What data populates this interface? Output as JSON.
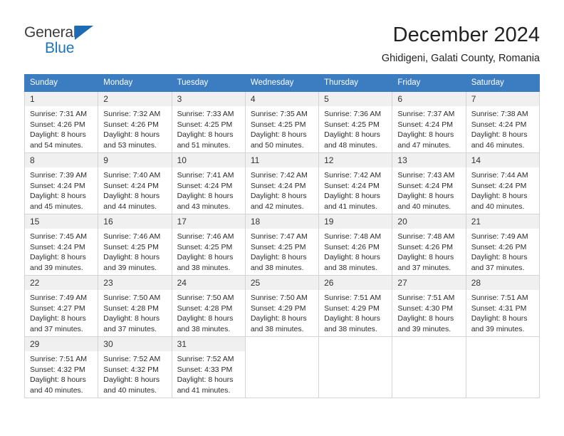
{
  "brand": {
    "line1": "General",
    "line2": "Blue",
    "triangle_color": "#1b6cb5"
  },
  "header": {
    "title": "December 2024",
    "subtitle": "Ghidigeni, Galati County, Romania"
  },
  "theme": {
    "header_bg": "#3b7dc0",
    "daynum_bg": "#f0f0f0",
    "border": "#d4d4d4"
  },
  "weekday_headers": [
    "Sunday",
    "Monday",
    "Tuesday",
    "Wednesday",
    "Thursday",
    "Friday",
    "Saturday"
  ],
  "weeks": [
    [
      {
        "day": "1",
        "sunrise": "Sunrise: 7:31 AM",
        "sunset": "Sunset: 4:26 PM",
        "daylight1": "Daylight: 8 hours",
        "daylight2": "and 54 minutes."
      },
      {
        "day": "2",
        "sunrise": "Sunrise: 7:32 AM",
        "sunset": "Sunset: 4:26 PM",
        "daylight1": "Daylight: 8 hours",
        "daylight2": "and 53 minutes."
      },
      {
        "day": "3",
        "sunrise": "Sunrise: 7:33 AM",
        "sunset": "Sunset: 4:25 PM",
        "daylight1": "Daylight: 8 hours",
        "daylight2": "and 51 minutes."
      },
      {
        "day": "4",
        "sunrise": "Sunrise: 7:35 AM",
        "sunset": "Sunset: 4:25 PM",
        "daylight1": "Daylight: 8 hours",
        "daylight2": "and 50 minutes."
      },
      {
        "day": "5",
        "sunrise": "Sunrise: 7:36 AM",
        "sunset": "Sunset: 4:25 PM",
        "daylight1": "Daylight: 8 hours",
        "daylight2": "and 48 minutes."
      },
      {
        "day": "6",
        "sunrise": "Sunrise: 7:37 AM",
        "sunset": "Sunset: 4:24 PM",
        "daylight1": "Daylight: 8 hours",
        "daylight2": "and 47 minutes."
      },
      {
        "day": "7",
        "sunrise": "Sunrise: 7:38 AM",
        "sunset": "Sunset: 4:24 PM",
        "daylight1": "Daylight: 8 hours",
        "daylight2": "and 46 minutes."
      }
    ],
    [
      {
        "day": "8",
        "sunrise": "Sunrise: 7:39 AM",
        "sunset": "Sunset: 4:24 PM",
        "daylight1": "Daylight: 8 hours",
        "daylight2": "and 45 minutes."
      },
      {
        "day": "9",
        "sunrise": "Sunrise: 7:40 AM",
        "sunset": "Sunset: 4:24 PM",
        "daylight1": "Daylight: 8 hours",
        "daylight2": "and 44 minutes."
      },
      {
        "day": "10",
        "sunrise": "Sunrise: 7:41 AM",
        "sunset": "Sunset: 4:24 PM",
        "daylight1": "Daylight: 8 hours",
        "daylight2": "and 43 minutes."
      },
      {
        "day": "11",
        "sunrise": "Sunrise: 7:42 AM",
        "sunset": "Sunset: 4:24 PM",
        "daylight1": "Daylight: 8 hours",
        "daylight2": "and 42 minutes."
      },
      {
        "day": "12",
        "sunrise": "Sunrise: 7:42 AM",
        "sunset": "Sunset: 4:24 PM",
        "daylight1": "Daylight: 8 hours",
        "daylight2": "and 41 minutes."
      },
      {
        "day": "13",
        "sunrise": "Sunrise: 7:43 AM",
        "sunset": "Sunset: 4:24 PM",
        "daylight1": "Daylight: 8 hours",
        "daylight2": "and 40 minutes."
      },
      {
        "day": "14",
        "sunrise": "Sunrise: 7:44 AM",
        "sunset": "Sunset: 4:24 PM",
        "daylight1": "Daylight: 8 hours",
        "daylight2": "and 40 minutes."
      }
    ],
    [
      {
        "day": "15",
        "sunrise": "Sunrise: 7:45 AM",
        "sunset": "Sunset: 4:24 PM",
        "daylight1": "Daylight: 8 hours",
        "daylight2": "and 39 minutes."
      },
      {
        "day": "16",
        "sunrise": "Sunrise: 7:46 AM",
        "sunset": "Sunset: 4:25 PM",
        "daylight1": "Daylight: 8 hours",
        "daylight2": "and 39 minutes."
      },
      {
        "day": "17",
        "sunrise": "Sunrise: 7:46 AM",
        "sunset": "Sunset: 4:25 PM",
        "daylight1": "Daylight: 8 hours",
        "daylight2": "and 38 minutes."
      },
      {
        "day": "18",
        "sunrise": "Sunrise: 7:47 AM",
        "sunset": "Sunset: 4:25 PM",
        "daylight1": "Daylight: 8 hours",
        "daylight2": "and 38 minutes."
      },
      {
        "day": "19",
        "sunrise": "Sunrise: 7:48 AM",
        "sunset": "Sunset: 4:26 PM",
        "daylight1": "Daylight: 8 hours",
        "daylight2": "and 38 minutes."
      },
      {
        "day": "20",
        "sunrise": "Sunrise: 7:48 AM",
        "sunset": "Sunset: 4:26 PM",
        "daylight1": "Daylight: 8 hours",
        "daylight2": "and 37 minutes."
      },
      {
        "day": "21",
        "sunrise": "Sunrise: 7:49 AM",
        "sunset": "Sunset: 4:26 PM",
        "daylight1": "Daylight: 8 hours",
        "daylight2": "and 37 minutes."
      }
    ],
    [
      {
        "day": "22",
        "sunrise": "Sunrise: 7:49 AM",
        "sunset": "Sunset: 4:27 PM",
        "daylight1": "Daylight: 8 hours",
        "daylight2": "and 37 minutes."
      },
      {
        "day": "23",
        "sunrise": "Sunrise: 7:50 AM",
        "sunset": "Sunset: 4:28 PM",
        "daylight1": "Daylight: 8 hours",
        "daylight2": "and 37 minutes."
      },
      {
        "day": "24",
        "sunrise": "Sunrise: 7:50 AM",
        "sunset": "Sunset: 4:28 PM",
        "daylight1": "Daylight: 8 hours",
        "daylight2": "and 38 minutes."
      },
      {
        "day": "25",
        "sunrise": "Sunrise: 7:50 AM",
        "sunset": "Sunset: 4:29 PM",
        "daylight1": "Daylight: 8 hours",
        "daylight2": "and 38 minutes."
      },
      {
        "day": "26",
        "sunrise": "Sunrise: 7:51 AM",
        "sunset": "Sunset: 4:29 PM",
        "daylight1": "Daylight: 8 hours",
        "daylight2": "and 38 minutes."
      },
      {
        "day": "27",
        "sunrise": "Sunrise: 7:51 AM",
        "sunset": "Sunset: 4:30 PM",
        "daylight1": "Daylight: 8 hours",
        "daylight2": "and 39 minutes."
      },
      {
        "day": "28",
        "sunrise": "Sunrise: 7:51 AM",
        "sunset": "Sunset: 4:31 PM",
        "daylight1": "Daylight: 8 hours",
        "daylight2": "and 39 minutes."
      }
    ],
    [
      {
        "day": "29",
        "sunrise": "Sunrise: 7:51 AM",
        "sunset": "Sunset: 4:32 PM",
        "daylight1": "Daylight: 8 hours",
        "daylight2": "and 40 minutes."
      },
      {
        "day": "30",
        "sunrise": "Sunrise: 7:52 AM",
        "sunset": "Sunset: 4:32 PM",
        "daylight1": "Daylight: 8 hours",
        "daylight2": "and 40 minutes."
      },
      {
        "day": "31",
        "sunrise": "Sunrise: 7:52 AM",
        "sunset": "Sunset: 4:33 PM",
        "daylight1": "Daylight: 8 hours",
        "daylight2": "and 41 minutes."
      },
      {
        "day": "",
        "sunrise": "",
        "sunset": "",
        "daylight1": "",
        "daylight2": ""
      },
      {
        "day": "",
        "sunrise": "",
        "sunset": "",
        "daylight1": "",
        "daylight2": ""
      },
      {
        "day": "",
        "sunrise": "",
        "sunset": "",
        "daylight1": "",
        "daylight2": ""
      },
      {
        "day": "",
        "sunrise": "",
        "sunset": "",
        "daylight1": "",
        "daylight2": ""
      }
    ]
  ]
}
